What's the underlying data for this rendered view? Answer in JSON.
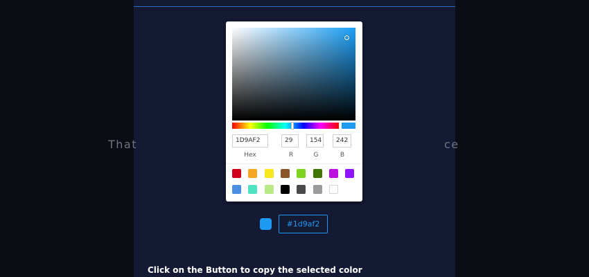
{
  "background_text": {
    "left": "That",
    "right": "ce"
  },
  "picker": {
    "hex_value": "1D9AF2",
    "r_value": "29",
    "g_value": "154",
    "b_value": "242",
    "hex_label": "Hex",
    "r_label": "R",
    "g_label": "G",
    "b_label": "B",
    "selected_color": "#1d9af2",
    "swatches_row1": [
      "#d0021b",
      "#f5a623",
      "#f8e71c",
      "#8b572a",
      "#7ed321",
      "#417505",
      "#bd10e0",
      "#9013fe"
    ],
    "swatches_row2": [
      "#4a90e2",
      "#50e3c2",
      "#b8e986",
      "#000000",
      "#4a4a4a",
      "#9b9b9b",
      "#ffffff"
    ]
  },
  "copy_button": {
    "label": "#1d9af2"
  },
  "instruction": "Click on the Button to copy the selected color",
  "colors": {
    "accent": "#1d9af2",
    "panel": "#141a33",
    "backdrop": "#0b0d15"
  }
}
